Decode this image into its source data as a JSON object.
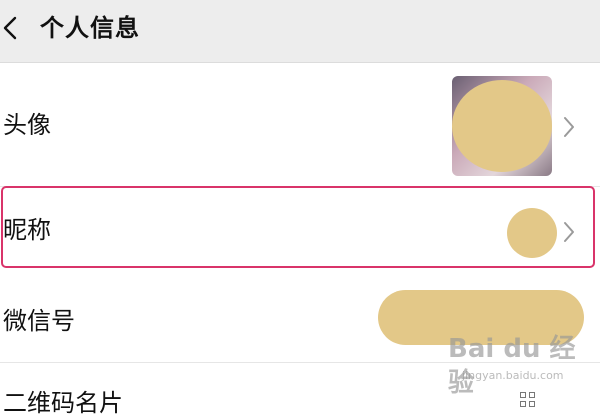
{
  "header": {
    "title": "个人信息",
    "back_icon": "chevron-left-icon"
  },
  "rows": [
    {
      "label": "头像",
      "value_kind": "avatar-image",
      "chevron": "chevron-right-icon"
    },
    {
      "label": "昵称",
      "value_kind": "redacted-nickname",
      "chevron": "chevron-right-icon",
      "highlighted": true
    },
    {
      "label": "微信号",
      "value_kind": "redacted-wechat-id"
    },
    {
      "label": "二维码名片",
      "value_kind": "qr-code-icon"
    }
  ],
  "highlight_color": "#d9346a",
  "redaction_color": "#e3c888",
  "header_bg": "#ededed",
  "watermark": {
    "main": "Bai du 经验",
    "sub": "jingyan.baidu.com"
  }
}
